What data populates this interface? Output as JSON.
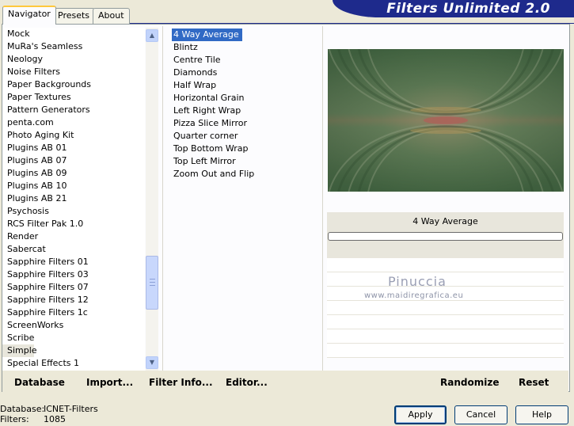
{
  "app": {
    "title": "Filters Unlimited 2.0"
  },
  "tabs": [
    {
      "label": "Navigator",
      "active": true
    },
    {
      "label": "Presets",
      "active": false
    },
    {
      "label": "About",
      "active": false
    }
  ],
  "categories": [
    "Mock",
    "MuRa's Seamless",
    "Neology",
    "Noise Filters",
    "Paper Backgrounds",
    "Paper Textures",
    "Pattern Generators",
    "penta.com",
    "Photo Aging Kit",
    "Plugins AB 01",
    "Plugins AB 07",
    "Plugins AB 09",
    "Plugins AB 10",
    "Plugins AB 21",
    "Psychosis",
    "RCS Filter Pak 1.0",
    "Render",
    "Sabercat",
    "Sapphire Filters 01",
    "Sapphire Filters 03",
    "Sapphire Filters 07",
    "Sapphire Filters 12",
    "Sapphire Filters 1c",
    "ScreenWorks",
    "Scribe",
    "Simple",
    "Special Effects 1"
  ],
  "selected_category": "Simple",
  "filters": [
    "4 Way Average",
    "Blintz",
    "Centre Tile",
    "Diamonds",
    "Half Wrap",
    "Horizontal Grain",
    "Left Right Wrap",
    "Pizza Slice Mirror",
    "Quarter corner",
    "Top Bottom Wrap",
    "Top Left Mirror",
    "Zoom Out and Flip"
  ],
  "selected_filter": "4 Way Average",
  "preview": {
    "filter_name": "4 Way Average",
    "watermark_name": "Pinuccia",
    "watermark_url": "www.maidiregrafica.eu"
  },
  "links": {
    "database": "Database",
    "import": "Import...",
    "filter_info": "Filter Info...",
    "editor": "Editor...",
    "randomize": "Randomize",
    "reset": "Reset"
  },
  "status": {
    "database_label": "Database:",
    "database_value": "ICNET-Filters",
    "filters_label": "Filters:",
    "filters_value": "1085"
  },
  "buttons": {
    "apply": "Apply",
    "cancel": "Cancel",
    "help": "Help"
  },
  "colors": {
    "banner": "#1e2a8c",
    "selection": "#316ac5",
    "window_bg": "#ece9d8",
    "preview_green": "#40643f"
  }
}
